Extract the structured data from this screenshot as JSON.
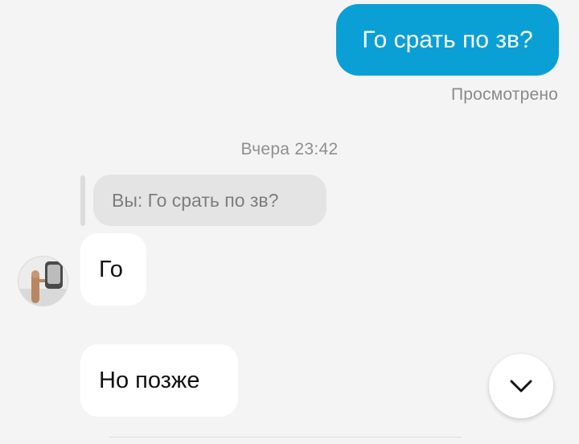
{
  "messages": {
    "outgoing_text": "Го срать по зв?",
    "seen_status": "Просмотрено",
    "timestamp": "Вчера 23:42",
    "reply_preview": "Вы: Го срать по зв?",
    "incoming": [
      {
        "text": "Го"
      },
      {
        "text": "Но позже"
      }
    ]
  },
  "colors": {
    "outgoing_bubble": "#0aa0d6",
    "background": "#f4f4f4",
    "incoming_bubble": "#ffffff",
    "reply_bubble": "#e4e4e4"
  },
  "icons": {
    "scroll_down": "chevron-down-icon",
    "avatar": "user-avatar-icon"
  }
}
